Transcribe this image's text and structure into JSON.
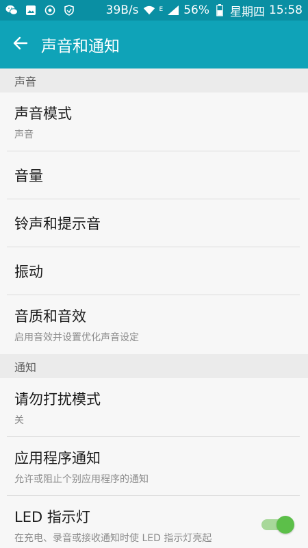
{
  "status_bar": {
    "speed": "39B/s",
    "network_label": "E",
    "battery": "56%",
    "weekday": "星期四",
    "time": "15:58"
  },
  "app_bar": {
    "title": "声音和通知"
  },
  "sections": [
    {
      "header": "声音",
      "items": [
        {
          "title": "声音模式",
          "subtitle": "声音"
        },
        {
          "title": "音量"
        },
        {
          "title": "铃声和提示音"
        },
        {
          "title": "振动"
        },
        {
          "title": "音质和音效",
          "subtitle": "启用音效并设置优化声音设定"
        }
      ]
    },
    {
      "header": "通知",
      "items": [
        {
          "title": "请勿打扰模式",
          "subtitle": "关"
        },
        {
          "title": "应用程序通知",
          "subtitle": "允许或阻止个别应用程序的通知"
        },
        {
          "title": "LED 指示灯",
          "subtitle": "在充电、录音或接收通知时使 LED 指示灯亮起",
          "toggle": true
        }
      ]
    }
  ],
  "colors": {
    "status_bar_bg": "#0a8fa3",
    "app_bar_bg": "#0fa3b8",
    "toggle_on": "#5cbf49"
  },
  "icons": [
    "wechat-icon",
    "image-icon",
    "target-icon",
    "shield-icon",
    "wifi-icon",
    "signal-icon",
    "battery-icon",
    "back-arrow-icon"
  ]
}
